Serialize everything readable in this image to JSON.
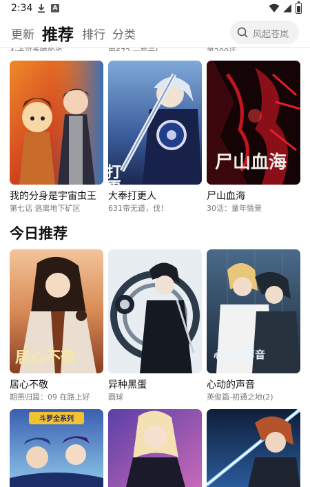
{
  "status_bar": {
    "time": "2:34",
    "badge": "A"
  },
  "nav": {
    "tabs": [
      {
        "label": "更新",
        "active": false
      },
      {
        "label": "推荐",
        "active": true
      },
      {
        "label": "排行",
        "active": false
      },
      {
        "label": "分类",
        "active": false
      }
    ],
    "search_placeholder": "风起苍岚"
  },
  "prev_row": [
    {
      "subtitle": "4:卡可香暗的步"
    },
    {
      "subtitle": "忠672 一趁云!"
    },
    {
      "subtitle": "第200话"
    }
  ],
  "row1": [
    {
      "title": "我的分身是宇宙虫王",
      "subtitle": "第七话 逃离地下矿区"
    },
    {
      "title": "大奉打更人",
      "subtitle": "631帝无道，伐！",
      "cover_text": "打更人"
    },
    {
      "title": "尸山血海",
      "subtitle": "30话：童年情景",
      "cover_text": "尸山血海"
    }
  ],
  "section": {
    "title": "今日推荐"
  },
  "row2": [
    {
      "title": "居心不敬",
      "subtitle": "期燕归篇：09 在路上好",
      "cover_text": "居心不敬"
    },
    {
      "title": "异种黑蛋",
      "subtitle": "圆球"
    },
    {
      "title": "心动的声音",
      "subtitle": "英俊篇-初通之地(2)",
      "cover_text": "心动的声音"
    }
  ],
  "row3": [
    {
      "cover_text": "斗罗全系列"
    },
    {
      "cover_text": ""
    },
    {
      "cover_text": ""
    }
  ],
  "colors": {
    "accent": "#111111",
    "muted": "#777777",
    "search_bg": "#f2f2f2"
  }
}
